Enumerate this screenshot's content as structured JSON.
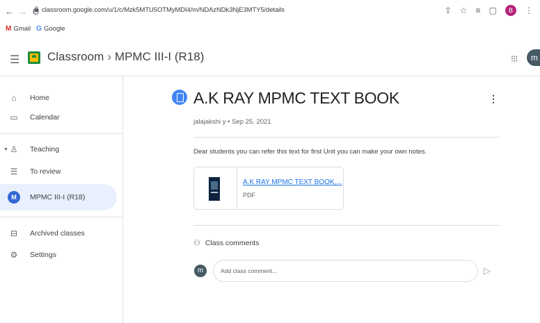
{
  "browser": {
    "url": "classroom.google.com/u/1/c/Mzk5MTU5OTMyMDI4/m/NDAzNDk3NjE3MTY5/details",
    "profile_initial": "B",
    "bookmarks": [
      {
        "label": "Gmail",
        "icon": "M"
      },
      {
        "label": "Google",
        "icon": "G"
      }
    ]
  },
  "header": {
    "app_name": "Classroom",
    "separator": "›",
    "class_name": "MPMC III-I (R18)",
    "avatar_initial": "m"
  },
  "sidebar": {
    "items": [
      {
        "label": "Home",
        "icon": "home-icon"
      },
      {
        "label": "Calendar",
        "icon": "calendar-icon"
      },
      {
        "label": "Teaching",
        "icon": "teaching-icon"
      },
      {
        "label": "To review",
        "icon": "to-review-icon"
      },
      {
        "label": "MPMC III-I (R18)",
        "icon": "class-badge",
        "badge": "M",
        "selected": true
      },
      {
        "label": "Archived classes",
        "icon": "archive-icon"
      },
      {
        "label": "Settings",
        "icon": "gear-icon"
      }
    ]
  },
  "post": {
    "title": "A.K RAY MPMC TEXT BOOK",
    "meta": "jalajakshi y • Sep 25, 2021",
    "body": "Dear students you can refer this text for first Unit you can make your own notes.",
    "attachment": {
      "title": "A.K RAY MPMC TEXT BOOK,...",
      "type": "PDF"
    }
  },
  "comments": {
    "header": "Class comments",
    "avatar_initial": "m",
    "placeholder": "Add class comment..."
  },
  "colors": {
    "accent": "#1a73e8",
    "selected_bg": "#e8f0fe",
    "class_badge": "#3367d6",
    "avatar": "#455a64"
  }
}
